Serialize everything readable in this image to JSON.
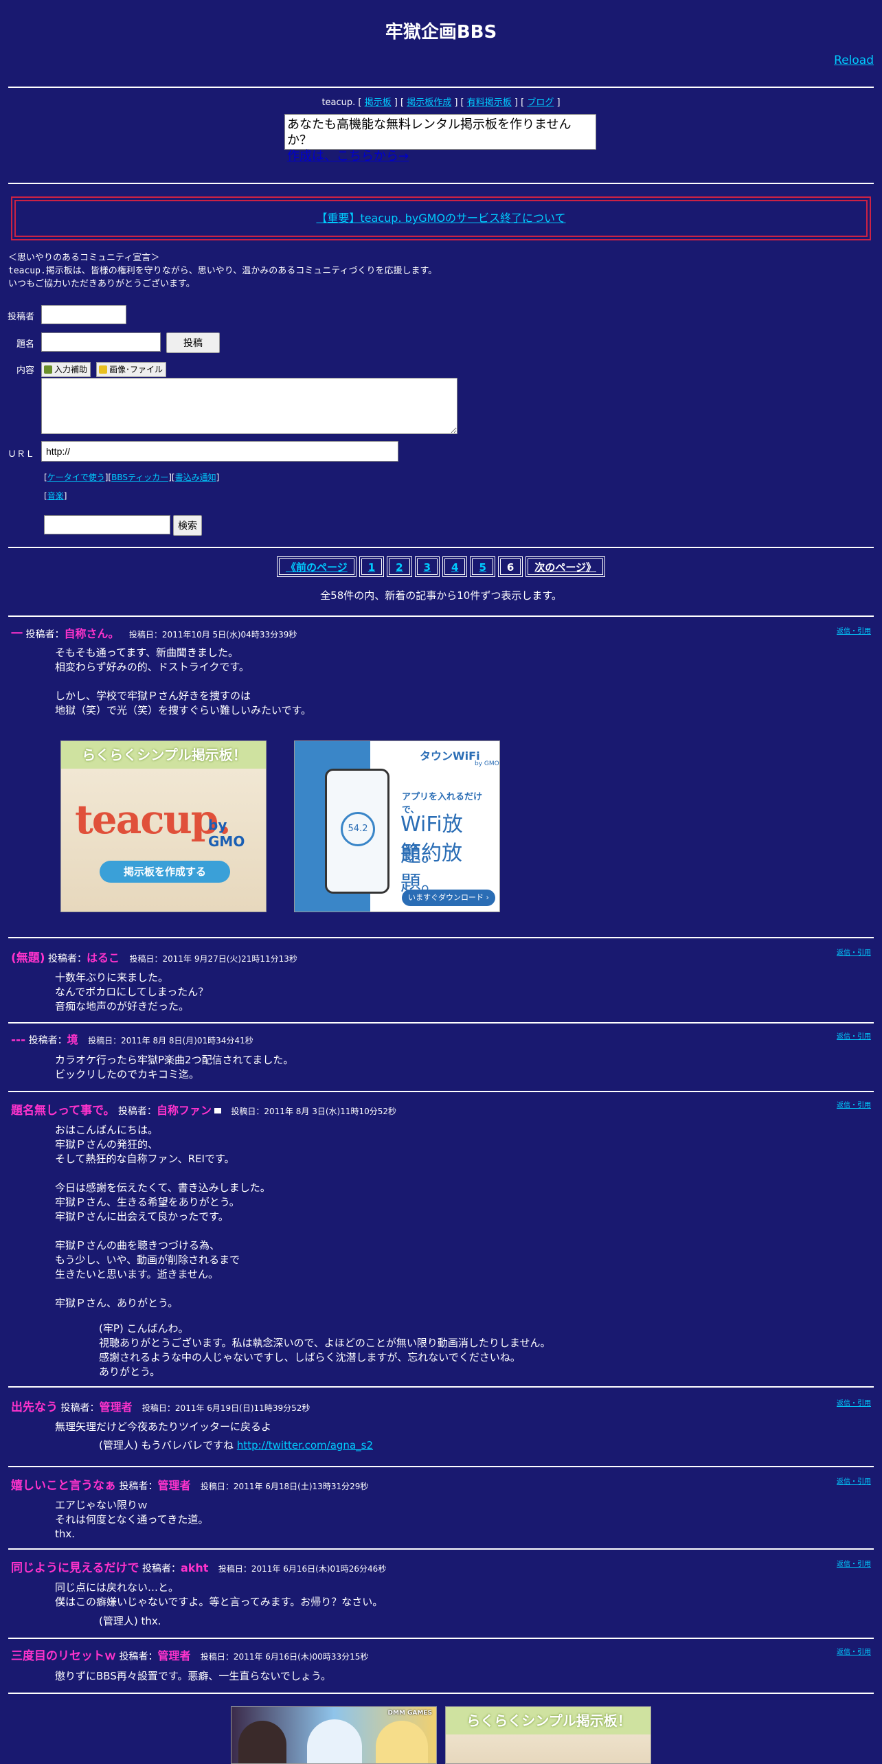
{
  "header": {
    "title": "牢獄企画BBS",
    "reload": "Reload"
  },
  "teacup_nav": {
    "brand": "teacup.",
    "links": [
      "掲示板",
      "掲示板作成",
      "有料掲示板",
      "ブログ"
    ]
  },
  "teacup_ad": {
    "line1": "あなたも高機能な無料レンタル掲示板を作りませんか？",
    "link": "作成は、こちらから→"
  },
  "notice": {
    "text": "【重要】teacup. byGMOのサービス終了について"
  },
  "declaration": {
    "line1": "＜思いやりのあるコミュニティ宣言＞",
    "line2": "teacup.掲示板は、皆様の権利を守りながら、思いやり、温かみのあるコミュニティづくりを応援します。",
    "line3": "いつもご協力いただきありがとうございます。"
  },
  "form": {
    "author_label": "投稿者",
    "subject_label": "題名",
    "content_label": "内容",
    "url_label": "ＵＲＬ",
    "url_value": "http://",
    "submit": "投稿",
    "assist_button": "入力補助",
    "image_button": "画像･ファイル",
    "links": [
      "ケータイで使う",
      "BBSティッカー",
      "書込み通知"
    ],
    "music_link": "音楽",
    "search_button": "検索"
  },
  "pager": {
    "prev": "《前のページ",
    "pages": [
      "1",
      "2",
      "3",
      "4",
      "5",
      "6"
    ],
    "current": "6",
    "next": "次のページ》",
    "note": "全58件の内、新着の記事から10件ずつ表示します。"
  },
  "reply_label": "返信・引用",
  "posts": [
    {
      "title": "一",
      "author_label": "投稿者：",
      "author": "自称さん。",
      "date": "投稿日：2011年10月 5日(水)04時33分39秒",
      "body": [
        "そもそも通ってます、新曲聞きました。",
        "相変わらず好みの的、ドストライクです。",
        "",
        "しかし、学校で牢獄Ｐさん好きを捜すのは",
        "地獄（笑）で光（笑）を捜すぐらい難しいみたいです。"
      ]
    },
    {
      "title": "(無題)",
      "author_label": "投稿者：",
      "author": "はるこ",
      "date": "投稿日：2011年 9月27日(火)21時11分13秒",
      "body": [
        "十数年ぶりに来ました。",
        "なんでボカロにしてしまったん？",
        "音痴な地声のが好きだった。"
      ]
    },
    {
      "title": "---",
      "author_label": "投稿者：",
      "author": "境",
      "date": "投稿日：2011年 8月 8日(月)01時34分41秒",
      "body": [
        "カラオケ行ったら牢獄P楽曲2つ配信されてました。",
        "ビックリしたのでカキコミ迄。"
      ]
    },
    {
      "title": "題名無しって事で。",
      "author_label": "投稿者：",
      "author": "自称ファン",
      "date": "投稿日：2011年 8月 3日(水)11時10分52秒",
      "body": [
        "おはこんばんにちは。",
        "牢獄Ｐさんの発狂的、",
        "そして熱狂的な自称ファン、REIです。",
        "",
        "今日は感謝を伝えたくて、書き込みしました。",
        "牢獄Ｐさん、生きる希望をありがとう。",
        "牢獄Ｐさんに出会えて良かったです。",
        "",
        "牢獄Ｐさんの曲を聴きつづける為、",
        "もう少し、いや、動画が削除されるまで",
        "生きたいと思います。逝きません。",
        "",
        "牢獄Ｐさん、ありがとう。"
      ],
      "admin": [
        "(牢P) こんばんわ。",
        "視聴ありがとうございます。私は執念深いので、よほどのことが無い限り動画消したりしません。",
        "感謝されるような中の人じゃないですし、しばらく沈潜しますが、忘れないでくださいね。",
        "ありがとう。"
      ]
    },
    {
      "title": "出先なう",
      "author_label": "投稿者：",
      "author": "管理者",
      "date": "投稿日：2011年 6月19日(日)11時39分52秒",
      "body": [
        "無理矢理だけど今夜あたりツイッターに戻るよ"
      ],
      "admin_prefix": "(管理人) もうバレバレですね",
      "admin_link": "http://twitter.com/agna_s2"
    },
    {
      "title": "嬉しいこと言うなぁ",
      "author_label": "投稿者：",
      "author": "管理者",
      "date": "投稿日：2011年 6月18日(土)13時31分29秒",
      "body": [
        "エアじゃない限りｗ",
        "それは何度となく通ってきた道。",
        "thx."
      ]
    },
    {
      "title": "同じように見えるだけで",
      "author_label": "投稿者：",
      "author": "akht",
      "date": "投稿日：2011年 6月16日(木)01時26分46秒",
      "body": [
        "同じ点には戻れない…と。",
        "僕はこの癖嫌いじゃないですよ。等と言ってみます。お帰り？なさい。"
      ],
      "admin": [
        "(管理人) thx."
      ]
    },
    {
      "title": "三度目のリセットｗ",
      "author_label": "投稿者：",
      "author": "管理者",
      "date": "投稿日：2011年 6月16日(木)00時33分15秒",
      "body": [
        "懲りずにBBS再々設置です。悪癖、一生直らないでしょう。"
      ]
    }
  ],
  "ads": {
    "teacup_banner": {
      "headline": "らくらくシンプル掲示板！",
      "logo": "teacup.",
      "by": "by GMO",
      "cta": "掲示板を作成する"
    },
    "wifi_banner": {
      "brand": "タウンWiFi",
      "by": "by GMO",
      "line1": "アプリを入れるだけで、",
      "line2": "WiFi放題。",
      "line3": "節約放題。",
      "cta": "いますぐダウンロード ›",
      "speed": "54.2"
    },
    "dmm_banner": {
      "brand": "DMM GAMES"
    },
    "teacup_banner2": {
      "headline": "らくらくシンプル掲示板！"
    }
  },
  "colors": {
    "background": "#191970",
    "accent": "#ff33cc",
    "link": "#00ccff",
    "notice_border": "#cc2244"
  }
}
